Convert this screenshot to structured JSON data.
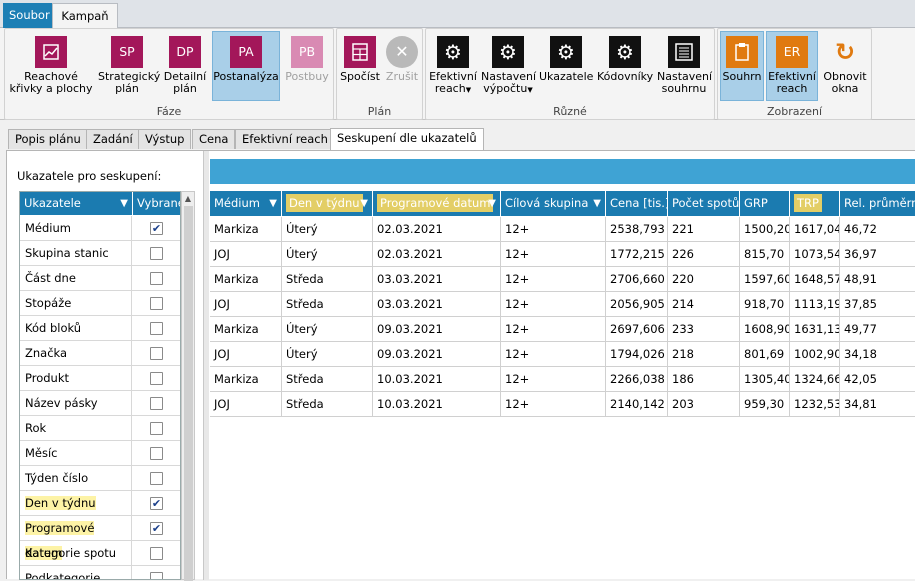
{
  "menu": {
    "tabs": [
      "Soubor",
      "Kampaň"
    ]
  },
  "ribbon": {
    "groups": [
      {
        "label": "Fáze",
        "buttons": [
          {
            "label": "Reachové\nkřivky a plochy",
            "icon": "chart-icon"
          },
          {
            "label": "Strategický\nplán",
            "icon": "SP"
          },
          {
            "label": "Detailní\nplán",
            "icon": "DP"
          },
          {
            "label": "Postanalýza",
            "icon": "PA"
          },
          {
            "label": "Postbuy",
            "icon": "PB"
          }
        ]
      },
      {
        "label": "Plán",
        "buttons": [
          {
            "label": "Spočíst",
            "icon": "calculator-icon"
          },
          {
            "label": "Zrušit",
            "icon": "cancel-icon"
          }
        ]
      },
      {
        "label": "Různé",
        "buttons": [
          {
            "label": "Efektivní\nreach",
            "icon": "gear-icon"
          },
          {
            "label": "Nastavení\nvýpočtu",
            "icon": "gear-icon"
          },
          {
            "label": "Ukazatele",
            "icon": "gear-icon"
          },
          {
            "label": "Kódovníky",
            "icon": "gear-icon"
          },
          {
            "label": "Nastavení\nsouhrnu",
            "icon": "list-icon"
          }
        ]
      },
      {
        "label": "Zobrazení",
        "buttons": [
          {
            "label": "Souhrn",
            "icon": "clipboard-icon"
          },
          {
            "label": "Efektivní\nreach",
            "icon": "ER"
          },
          {
            "label": "Obnovit\nokna",
            "icon": "refresh-icon"
          }
        ]
      }
    ]
  },
  "tabs": [
    "Popis plánu",
    "Zadání",
    "Výstup",
    "Cena",
    "Efektivní reach",
    "Seskupení dle ukazatelů"
  ],
  "left": {
    "heading": "Ukazatele pro seskupení:",
    "columns": [
      "Ukazatele",
      "Vybrané"
    ],
    "rows": [
      {
        "name": "Médium",
        "checked": true,
        "highlight": false
      },
      {
        "name": "Skupina stanic",
        "checked": false,
        "highlight": false
      },
      {
        "name": "Část dne",
        "checked": false,
        "highlight": false
      },
      {
        "name": "Stopáže",
        "checked": false,
        "highlight": false
      },
      {
        "name": "Kód bloků",
        "checked": false,
        "highlight": false
      },
      {
        "name": "Značka",
        "checked": false,
        "highlight": false
      },
      {
        "name": "Produkt",
        "checked": false,
        "highlight": false
      },
      {
        "name": "Název pásky",
        "checked": false,
        "highlight": false
      },
      {
        "name": "Rok",
        "checked": false,
        "highlight": false
      },
      {
        "name": "Měsíc",
        "checked": false,
        "highlight": false
      },
      {
        "name": "Týden číslo",
        "checked": false,
        "highlight": false
      },
      {
        "name": "Den v týdnu",
        "checked": true,
        "highlight": true
      },
      {
        "name": "Programové datum",
        "checked": true,
        "highlight": true
      },
      {
        "name": "Kategorie spotu",
        "checked": false,
        "highlight": false
      },
      {
        "name": "Podkategorie spotu",
        "checked": false,
        "highlight": false
      }
    ]
  },
  "grid": {
    "columns": [
      {
        "label": "Médium",
        "filter": true,
        "gold": false
      },
      {
        "label": "Den v týdnu",
        "filter": true,
        "gold": true
      },
      {
        "label": "Programové datum",
        "filter": true,
        "gold": true
      },
      {
        "label": "Cílová skupina",
        "filter": true,
        "gold": false
      },
      {
        "label": "Cena [tis.]",
        "filter": false,
        "gold": false
      },
      {
        "label": "Počet spotů",
        "filter": false,
        "gold": false
      },
      {
        "label": "GRP",
        "filter": false,
        "gold": false
      },
      {
        "label": "TRP",
        "filter": false,
        "gold": true
      },
      {
        "label": "Rel. průměrná",
        "filter": false,
        "gold": false
      }
    ],
    "rows": [
      [
        "Markiza",
        "Úterý",
        "02.03.2021",
        "12+",
        "2538,793",
        "221",
        "1500,20",
        "1617,04",
        "46,72"
      ],
      [
        "JOJ",
        "Úterý",
        "02.03.2021",
        "12+",
        "1772,215",
        "226",
        "815,70",
        "1073,54",
        "36,97"
      ],
      [
        "Markiza",
        "Středa",
        "03.03.2021",
        "12+",
        "2706,660",
        "220",
        "1597,60",
        "1648,57",
        "48,91"
      ],
      [
        "JOJ",
        "Středa",
        "03.03.2021",
        "12+",
        "2056,905",
        "214",
        "918,70",
        "1113,19",
        "37,85"
      ],
      [
        "Markiza",
        "Úterý",
        "09.03.2021",
        "12+",
        "2697,606",
        "233",
        "1608,90",
        "1631,13",
        "49,77"
      ],
      [
        "JOJ",
        "Úterý",
        "09.03.2021",
        "12+",
        "1794,026",
        "218",
        "801,69",
        "1002,90",
        "34,18"
      ],
      [
        "Markiza",
        "Středa",
        "10.03.2021",
        "12+",
        "2266,038",
        "186",
        "1305,40",
        "1324,66",
        "42,05"
      ],
      [
        "JOJ",
        "Středa",
        "10.03.2021",
        "12+",
        "2140,142",
        "203",
        "959,30",
        "1232,53",
        "34,81"
      ]
    ]
  },
  "colors": {
    "accent": "#1b7bb0",
    "highlight": "#e3ce66",
    "magenta": "#a3175a",
    "orange": "#e07a10"
  }
}
